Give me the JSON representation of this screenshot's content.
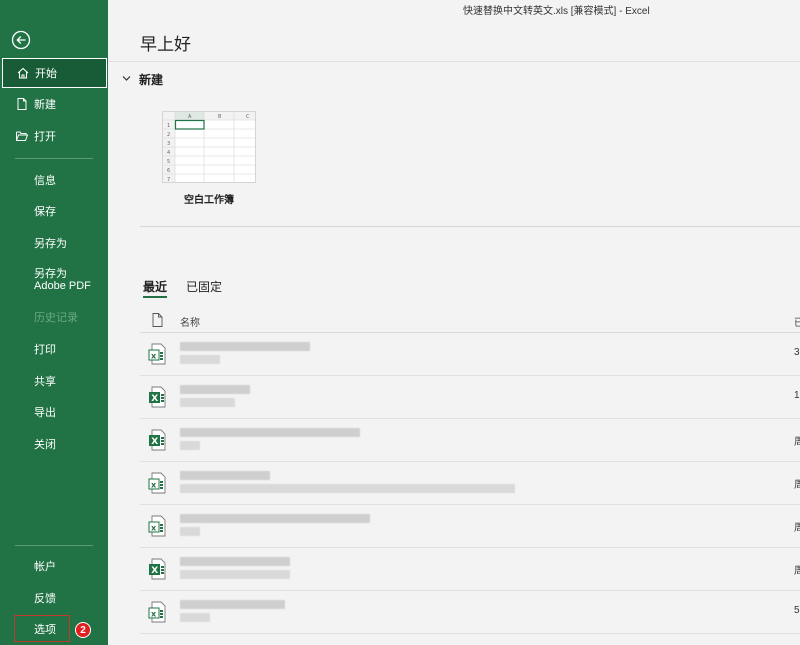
{
  "window": {
    "title": "快速替换中文转英文.xls  [兼容模式]  -  Excel"
  },
  "sidebar": {
    "items": [
      {
        "label": "开始"
      },
      {
        "label": "新建"
      },
      {
        "label": "打开"
      },
      {
        "label": "信息"
      },
      {
        "label": "保存"
      },
      {
        "label": "另存为"
      },
      {
        "label": "另存为 Adobe PDF"
      },
      {
        "label": "历史记录"
      },
      {
        "label": "打印"
      },
      {
        "label": "共享"
      },
      {
        "label": "导出"
      },
      {
        "label": "关闭"
      },
      {
        "label": "帐户"
      },
      {
        "label": "反馈"
      },
      {
        "label": "选项"
      }
    ],
    "options_badge": "2",
    "colors": {
      "bg": "#217346",
      "active": "#185c37",
      "highlight": "#c0392b"
    }
  },
  "main": {
    "greeting": "早上好",
    "new_section": "新建",
    "blank_workbook": "空白工作簿",
    "thumb": {
      "cols": [
        "A",
        "B",
        "C"
      ],
      "rows": [
        "1",
        "2",
        "3",
        "4",
        "5",
        "6",
        "7"
      ]
    },
    "tabs": [
      {
        "label": "最近"
      },
      {
        "label": "已固定"
      }
    ],
    "list_header": {
      "name": "名称",
      "date": "已"
    },
    "rows": [
      {
        "date": "3",
        "icon": "xls-icon"
      },
      {
        "date": "1",
        "icon": "xlsx-icon"
      },
      {
        "date": "周",
        "icon": "xlsx-icon"
      },
      {
        "date": "周",
        "icon": "xls-icon"
      },
      {
        "date": "周",
        "icon": "xls-icon"
      },
      {
        "date": "周",
        "icon": "xlsx-icon"
      },
      {
        "date": "5",
        "icon": "xls-icon"
      }
    ]
  }
}
